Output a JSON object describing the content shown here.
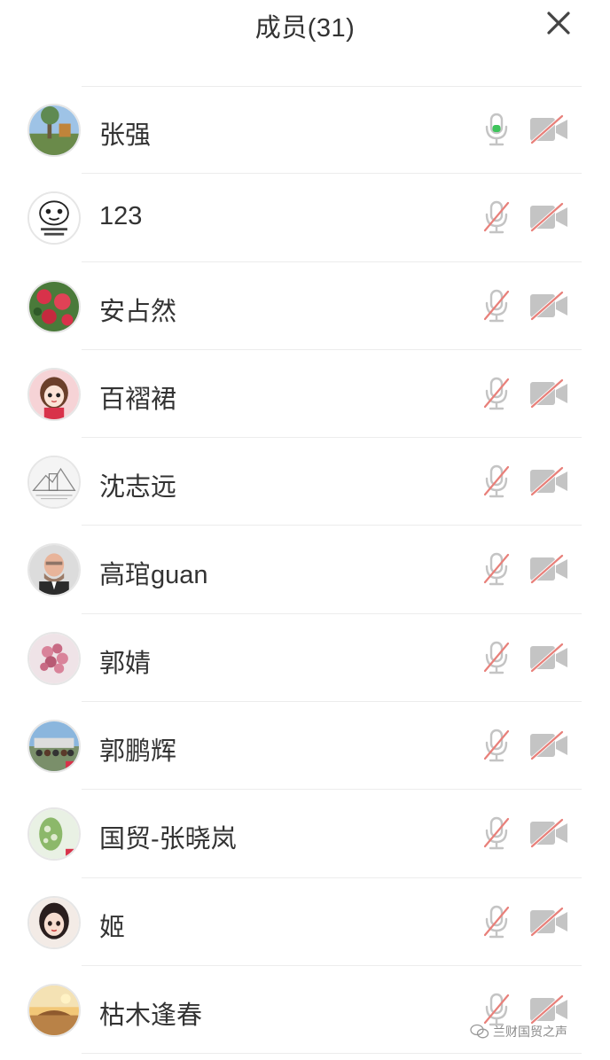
{
  "header": {
    "title": "成员(31)",
    "close_icon": "close-icon"
  },
  "members": [
    {
      "name": "张强",
      "mic": "on",
      "camera": "off",
      "avatar": "photo-landscape"
    },
    {
      "name": "123",
      "mic": "off",
      "camera": "off",
      "avatar": "cartoon-face"
    },
    {
      "name": "安占然",
      "mic": "off",
      "camera": "off",
      "avatar": "red-flowers"
    },
    {
      "name": "百褶裙",
      "mic": "off",
      "camera": "off",
      "avatar": "cartoon-girl"
    },
    {
      "name": "沈志远",
      "mic": "off",
      "camera": "off",
      "avatar": "sketch-drawing"
    },
    {
      "name": "高琯guan",
      "mic": "off",
      "camera": "off",
      "avatar": "man-portrait"
    },
    {
      "name": "郭婧",
      "mic": "off",
      "camera": "off",
      "avatar": "pink-berries"
    },
    {
      "name": "郭鹏辉",
      "mic": "off",
      "camera": "off",
      "avatar": "group-photo"
    },
    {
      "name": "国贸-张晓岚",
      "mic": "off",
      "camera": "off",
      "avatar": "green-plant"
    },
    {
      "name": "姬",
      "mic": "off",
      "camera": "off",
      "avatar": "anime-woman"
    },
    {
      "name": "枯木逢春",
      "mic": "off",
      "camera": "off",
      "avatar": "sunset-photo"
    }
  ],
  "colors": {
    "mic_active": "#3ec45b",
    "mute_slash": "#e8807a",
    "icon_gray": "#c4c4c4"
  },
  "watermark": {
    "text": "兰财国贸之声",
    "icon": "wechat-icon"
  }
}
